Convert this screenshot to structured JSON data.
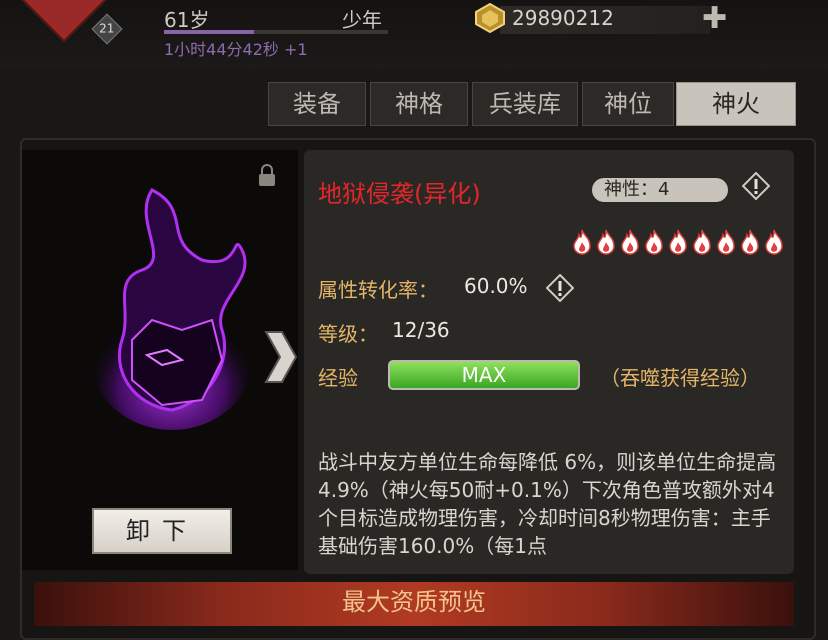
{
  "header": {
    "avatar_level": "21",
    "age": "61岁",
    "age_stage": "少年",
    "timer": "1小时44分42秒 +1",
    "gems": "29890212"
  },
  "tabs": [
    {
      "label": "装备",
      "active": false
    },
    {
      "label": "神格",
      "active": false
    },
    {
      "label": "兵装库",
      "active": false
    },
    {
      "label": "神位",
      "active": false
    },
    {
      "label": "神火",
      "active": true
    }
  ],
  "item": {
    "name": "地狱侵袭(异化)",
    "divinity": "神性：4",
    "flame_count": 9,
    "rate_label": "属性转化率：",
    "rate_value": "60.0%",
    "level_label": "等级：",
    "level_value": "12/36",
    "exp_label": "经验",
    "exp_value": "MAX",
    "devour_hint": "（吞噬获得经验）",
    "description": "战斗中友方单位生命每降低 6%，则该单位生命提高 4.9%（神火每50耐+0.1%）下次角色普攻额外对4个目标造成物理伤害，冷却时间8秒物理伤害：主手基础伤害160.0%（每1点"
  },
  "buttons": {
    "unload": "卸下"
  },
  "preview": {
    "label": "最大资质预览"
  },
  "colors": {
    "name_red": "#e2262a",
    "label_gold": "#e2b568",
    "exp_green": "#4cbf2e",
    "flame_purple": "#a020e0"
  }
}
